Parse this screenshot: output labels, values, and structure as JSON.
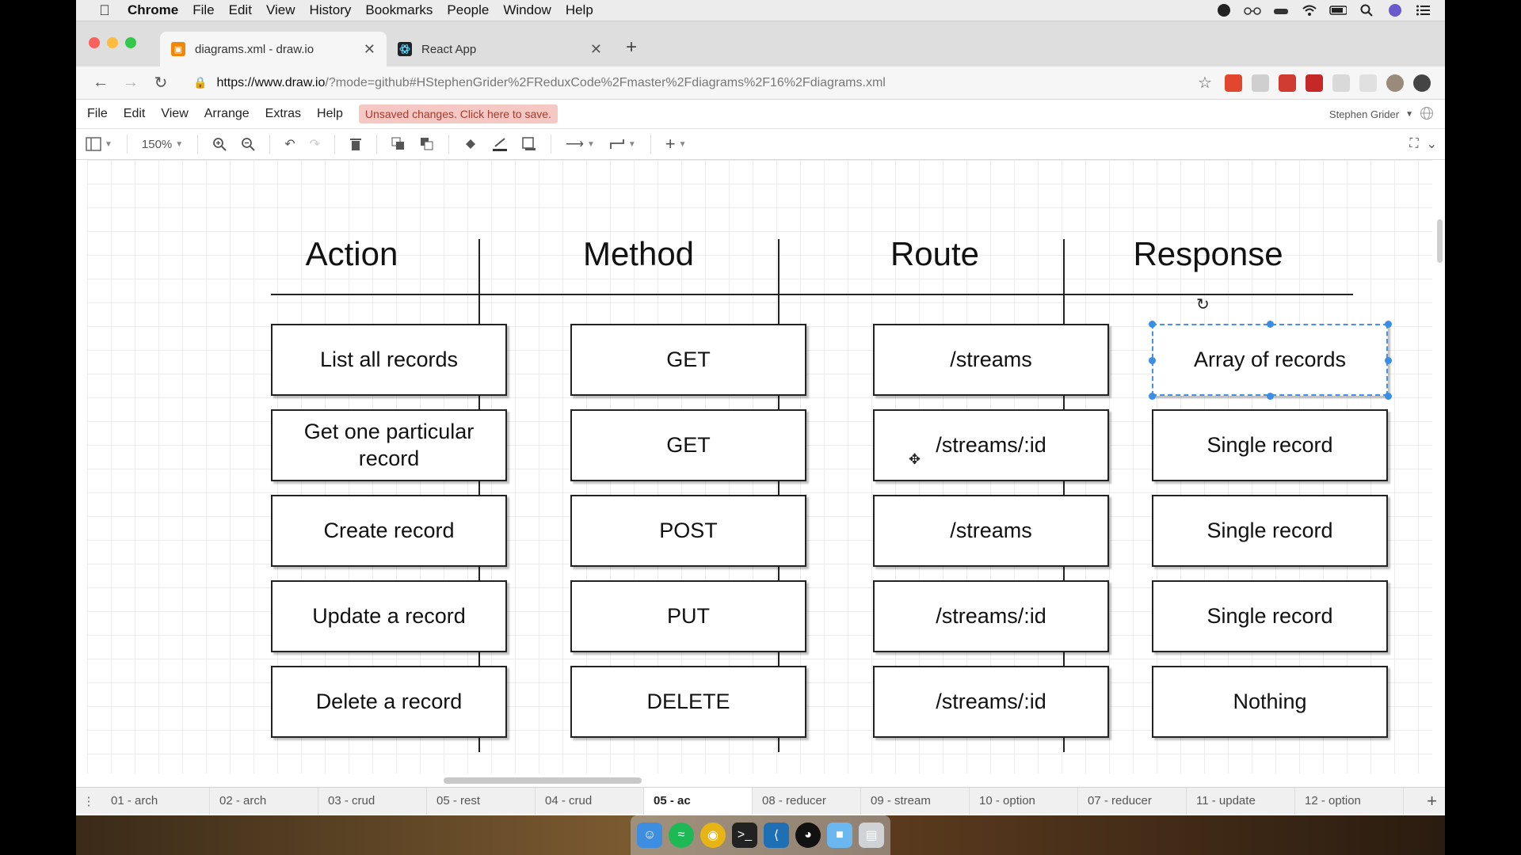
{
  "mac_menu": {
    "app": "Chrome",
    "items": [
      "File",
      "Edit",
      "View",
      "History",
      "Bookmarks",
      "People",
      "Window",
      "Help"
    ]
  },
  "browser": {
    "tabs": [
      {
        "title": "diagrams.xml - draw.io",
        "active": true
      },
      {
        "title": "React App",
        "active": false
      }
    ],
    "url_host": "https://www.draw.io",
    "url_rest": "/?mode=github#HStephenGrider%2FReduxCode%2Fmaster%2Fdiagrams%2F16%2Fdiagrams.xml"
  },
  "drawio": {
    "menu": [
      "File",
      "Edit",
      "View",
      "Arrange",
      "Extras",
      "Help"
    ],
    "unsaved_notice": "Unsaved changes. Click here to save.",
    "user": "Stephen Grider",
    "zoom": "150%"
  },
  "diagram": {
    "headers": [
      "Action",
      "Method",
      "Route",
      "Response"
    ],
    "rows": [
      [
        "List all records",
        "GET",
        "/streams",
        "Array of records"
      ],
      [
        "Get one particular record",
        "GET",
        "/streams/:id",
        "Single record"
      ],
      [
        "Create record",
        "POST",
        "/streams",
        "Single record"
      ],
      [
        "Update a record",
        "PUT",
        "/streams/:id",
        "Single record"
      ],
      [
        "Delete a record",
        "DELETE",
        "/streams/:id",
        "Nothing"
      ]
    ]
  },
  "page_tabs": [
    "01 - arch",
    "02 - arch",
    "03 - crud",
    "05 - rest",
    "04 - crud",
    "05 - ac",
    "08 - reducer",
    "09 - stream",
    "10 - option",
    "07 - reducer",
    "11 - update",
    "12 - option"
  ],
  "active_page_tab": "05 - ac",
  "colors": {
    "selection": "#3a8ee6",
    "unsaved_bg": "#f6c8c3"
  }
}
